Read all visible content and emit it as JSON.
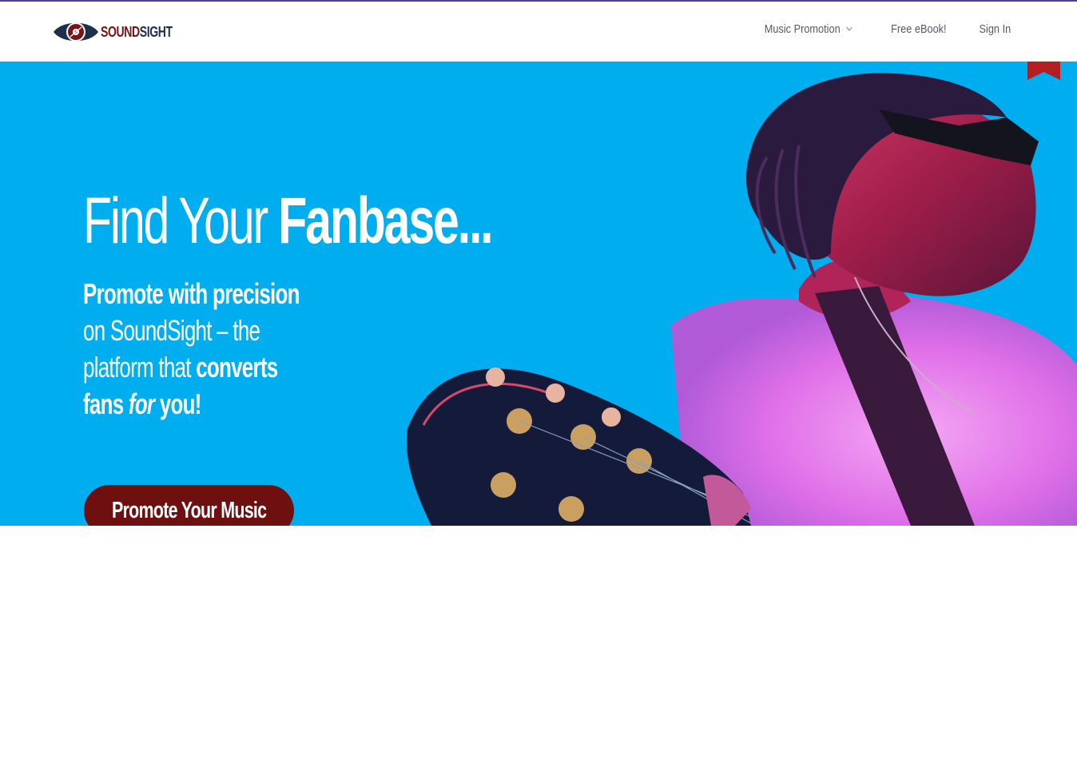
{
  "brand": {
    "name_part1": "SOUND",
    "name_part2": "SIGHT",
    "colors": {
      "primary": "#7a1316",
      "navy": "#1d2f4d",
      "hero_bg": "#00aeef",
      "cta_bg": "#6e0f10"
    }
  },
  "nav": {
    "items": [
      {
        "label": "Music Promotion",
        "has_dropdown": true
      },
      {
        "label": "Free eBook!"
      },
      {
        "label": "Sign In"
      }
    ]
  },
  "hero": {
    "headline_light": "Find Your ",
    "headline_bold": "Fanbase...",
    "sub_b1": "Promote with precision",
    "sub_t1": " on SoundSight – the platform that ",
    "sub_b2": "converts fans ",
    "sub_i": "for",
    "sub_b3": " you!",
    "cta_label": "Promote Your Music"
  }
}
